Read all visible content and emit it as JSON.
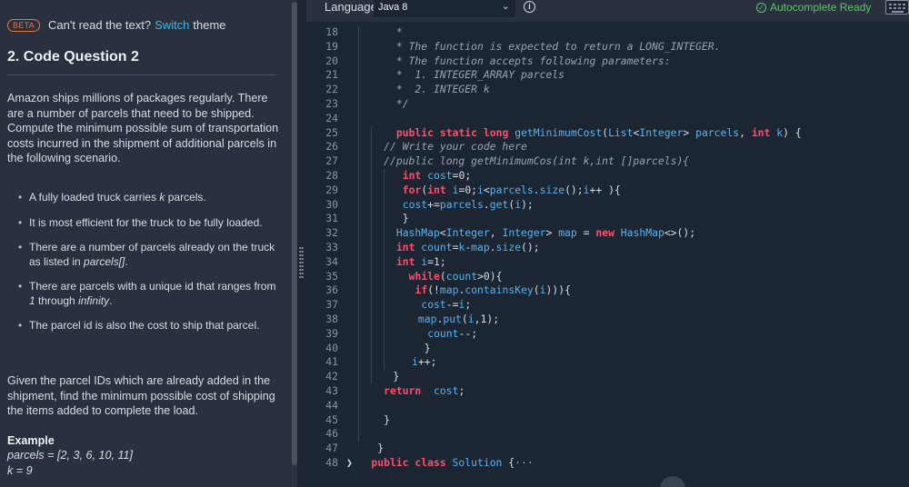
{
  "left": {
    "beta_badge": "BETA",
    "theme_prompt": "Can't read the text?",
    "theme_link": "Switch",
    "theme_suffix": "theme",
    "question_title": "2. Code Question 2",
    "intro": "Amazon ships millions of packages regularly. There are a number of parcels that need to be shipped. Compute the minimum possible sum of transportation costs incurred in the shipment of additional parcels in the following scenario.",
    "bullets": [
      {
        "pre": "A fully loaded truck carries ",
        "em": "k",
        "post": " parcels."
      },
      {
        "pre": "It is most efficient for the truck to be fully loaded.",
        "em": "",
        "post": ""
      },
      {
        "pre": "There are a number of parcels already on the truck as listed in ",
        "em": "parcels[]",
        "post": "."
      },
      {
        "pre": "There are parcels with a unique id that ranges from ",
        "em": "1",
        "post": " through ",
        "em2": "infinity",
        "post2": "."
      },
      {
        "pre": "The parcel id is also the cost to ship that parcel.",
        "em": "",
        "post": ""
      }
    ],
    "given": "Given the parcel IDs which are already added in the shipment, find the minimum possible cost of shipping the items added to complete the load.",
    "example_title": "Example",
    "example_parcels": "parcels = [2, 3, 6, 10, 11]",
    "example_k": "k = 9"
  },
  "toolbar": {
    "language_label": "Language",
    "language_value": "Java 8",
    "autocomplete_status": "Autocomplete Ready",
    "status_color": "#5fc56a",
    "icons": [
      "chevron-down-icon",
      "info-icon",
      "check-circle-icon",
      "keyboard-icon"
    ]
  },
  "code": {
    "lines": [
      {
        "n": "18",
        "tokens": [
          [
            "c",
            "*"
          ]
        ],
        "indent": 1
      },
      {
        "n": "19",
        "tokens": [
          [
            "c",
            "* The function is expected to return a LONG_INTEGER."
          ]
        ],
        "indent": 1
      },
      {
        "n": "20",
        "tokens": [
          [
            "c",
            "* The function accepts following parameters:"
          ]
        ],
        "indent": 1
      },
      {
        "n": "21",
        "tokens": [
          [
            "c",
            "*  1. INTEGER_ARRAY parcels"
          ]
        ],
        "indent": 1
      },
      {
        "n": "22",
        "tokens": [
          [
            "c",
            "*  2. INTEGER k"
          ]
        ],
        "indent": 1
      },
      {
        "n": "23",
        "tokens": [
          [
            "c",
            "*/"
          ]
        ],
        "indent": 1
      },
      {
        "n": "24",
        "tokens": [],
        "indent": 0
      },
      {
        "n": "25",
        "tokens": [
          [
            "k",
            "public"
          ],
          [
            "p",
            " "
          ],
          [
            "k",
            "static"
          ],
          [
            "p",
            " "
          ],
          [
            "k",
            "long"
          ],
          [
            "p",
            " "
          ],
          [
            "f",
            "getMinimumCost"
          ],
          [
            "p",
            "("
          ],
          [
            "t",
            "List"
          ],
          [
            "p",
            "<"
          ],
          [
            "t",
            "Integer"
          ],
          [
            "p",
            "> "
          ],
          [
            "t",
            "parcels"
          ],
          [
            "p",
            ", "
          ],
          [
            "k",
            "int"
          ],
          [
            "p",
            " "
          ],
          [
            "t",
            "k"
          ],
          [
            "p",
            ") {"
          ]
        ],
        "indent": 1
      },
      {
        "n": "26",
        "tokens": [
          [
            "c",
            "// Write your code here"
          ]
        ],
        "indent": 0,
        "shift": -1
      },
      {
        "n": "27",
        "tokens": [
          [
            "c",
            "//public long getMinimumCos(int k,int []parcels){"
          ]
        ],
        "indent": 0,
        "shift": -1
      },
      {
        "n": "28",
        "tokens": [
          [
            "k",
            "int"
          ],
          [
            "p",
            " "
          ],
          [
            "t",
            "cost"
          ],
          [
            "p",
            "=0;"
          ]
        ],
        "indent": 2
      },
      {
        "n": "29",
        "tokens": [
          [
            "k",
            "for"
          ],
          [
            "p",
            "("
          ],
          [
            "k",
            "int"
          ],
          [
            "p",
            " "
          ],
          [
            "t",
            "i"
          ],
          [
            "p",
            "=0;"
          ],
          [
            "t",
            "i"
          ],
          [
            "p",
            "<"
          ],
          [
            "t",
            "parcels"
          ],
          [
            "p",
            "."
          ],
          [
            "f",
            "size"
          ],
          [
            "p",
            "();"
          ],
          [
            "t",
            "i"
          ],
          [
            "p",
            "++ ){"
          ]
        ],
        "indent": 2
      },
      {
        "n": "30",
        "tokens": [
          [
            "t",
            "cost"
          ],
          [
            "p",
            "+="
          ],
          [
            "t",
            "parcels"
          ],
          [
            "p",
            "."
          ],
          [
            "f",
            "get"
          ],
          [
            "p",
            "("
          ],
          [
            "t",
            "i"
          ],
          [
            "p",
            ");"
          ]
        ],
        "indent": 2
      },
      {
        "n": "31",
        "tokens": [
          [
            "p",
            "}"
          ]
        ],
        "indent": 2
      },
      {
        "n": "32",
        "tokens": [
          [
            "t",
            "HashMap"
          ],
          [
            "p",
            "<"
          ],
          [
            "t",
            "Integer"
          ],
          [
            "p",
            ", "
          ],
          [
            "t",
            "Integer"
          ],
          [
            "p",
            "> "
          ],
          [
            "t",
            "map"
          ],
          [
            "p",
            " = "
          ],
          [
            "k",
            "new"
          ],
          [
            "p",
            " "
          ],
          [
            "t",
            "HashMap"
          ],
          [
            "p",
            "<>();"
          ]
        ],
        "indent": 1
      },
      {
        "n": "33",
        "tokens": [
          [
            "k",
            "int"
          ],
          [
            "p",
            " "
          ],
          [
            "t",
            "count"
          ],
          [
            "p",
            "="
          ],
          [
            "t",
            "k"
          ],
          [
            "p",
            "-"
          ],
          [
            "t",
            "map"
          ],
          [
            "p",
            "."
          ],
          [
            "f",
            "size"
          ],
          [
            "p",
            "();"
          ]
        ],
        "indent": 1
      },
      {
        "n": "34",
        "tokens": [
          [
            "k",
            "int"
          ],
          [
            "p",
            " "
          ],
          [
            "t",
            "i"
          ],
          [
            "p",
            "=1;"
          ]
        ],
        "indent": 1
      },
      {
        "n": "35",
        "tokens": [
          [
            "k",
            "while"
          ],
          [
            "p",
            "("
          ],
          [
            "t",
            "count"
          ],
          [
            "p",
            ">0){"
          ]
        ],
        "indent": 3
      },
      {
        "n": "36",
        "tokens": [
          [
            "k",
            "if"
          ],
          [
            "p",
            "(!"
          ],
          [
            "t",
            "map"
          ],
          [
            "p",
            "."
          ],
          [
            "f",
            "containsKey"
          ],
          [
            "p",
            "("
          ],
          [
            "t",
            "i"
          ],
          [
            "p",
            "))){"
          ]
        ],
        "indent": 4
      },
      {
        "n": "37",
        "tokens": [
          [
            "t",
            "cost"
          ],
          [
            "p",
            "-="
          ],
          [
            "t",
            "i"
          ],
          [
            "p",
            ";"
          ]
        ],
        "indent": 5
      },
      {
        "n": "38",
        "tokens": [
          [
            "t",
            "map"
          ],
          [
            "p",
            "."
          ],
          [
            "f",
            "put"
          ],
          [
            "p",
            "("
          ],
          [
            "t",
            "i"
          ],
          [
            "p",
            ",1);"
          ]
        ],
        "indent": 4.5
      },
      {
        "n": "39",
        "tokens": [
          [
            "t",
            "count"
          ],
          [
            "p",
            "--;"
          ]
        ],
        "indent": 6
      },
      {
        "n": "40",
        "tokens": [
          [
            "p",
            "}"
          ]
        ],
        "indent": 5.5
      },
      {
        "n": "41",
        "tokens": [
          [
            "t",
            "i"
          ],
          [
            "p",
            "++;"
          ]
        ],
        "indent": 3.5
      },
      {
        "n": "42",
        "tokens": [
          [
            "p",
            "}"
          ]
        ],
        "indent": 0.5
      },
      {
        "n": "43",
        "tokens": [
          [
            "k",
            "return"
          ],
          [
            "p",
            "  "
          ],
          [
            "t",
            "cost"
          ],
          [
            "p",
            ";"
          ]
        ],
        "indent": -1
      },
      {
        "n": "44",
        "tokens": [],
        "indent": 0
      },
      {
        "n": "45",
        "tokens": [
          [
            "p",
            "}"
          ]
        ],
        "indent": -1
      },
      {
        "n": "46",
        "tokens": [],
        "indent": 0
      },
      {
        "n": "47",
        "tokens": [
          [
            "p",
            "}"
          ]
        ],
        "indent": -2
      },
      {
        "n": "48",
        "tokens": [
          [
            "k",
            "public"
          ],
          [
            "p",
            " "
          ],
          [
            "k",
            "class"
          ],
          [
            "p",
            " "
          ],
          [
            "t",
            "Solution"
          ],
          [
            "p",
            " {"
          ],
          [
            "c",
            "···"
          ]
        ],
        "indent": -3,
        "fold": "❯"
      }
    ]
  }
}
